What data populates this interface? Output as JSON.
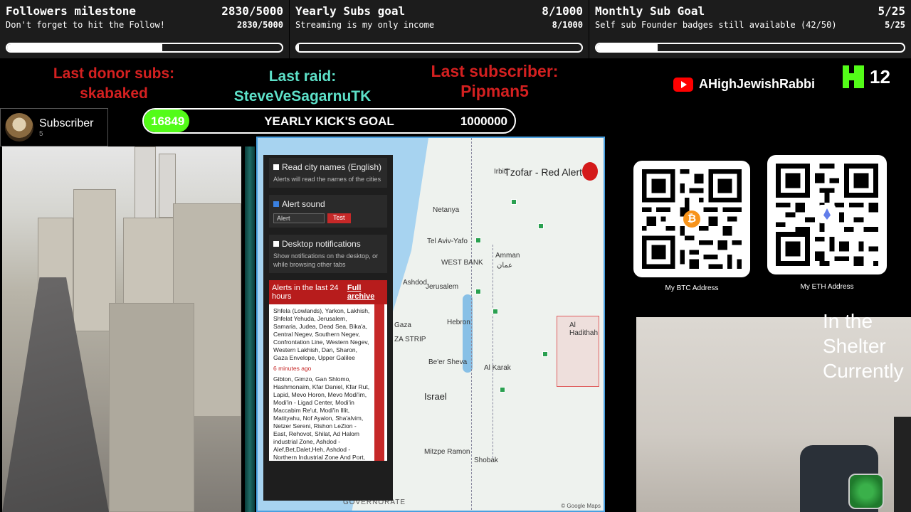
{
  "goals": [
    {
      "title": "Followers milestone",
      "count": "2830/5000",
      "subtitle": "Don't forget to hit the Follow!",
      "sub_count": "2830/5000",
      "progress": 0.566
    },
    {
      "title": "Yearly Subs goal",
      "count": "8/1000",
      "subtitle": "Streaming is my only income",
      "sub_count": "8/1000",
      "progress": 0.008
    },
    {
      "title": "Monthly Sub Goal",
      "count": "5/25",
      "subtitle": "Self sub Founder badges still available (42/50)",
      "sub_count": "5/25",
      "progress": 0.2
    }
  ],
  "events": {
    "donor_label": "Last donor subs:",
    "donor_name": "skabaked",
    "raid_label": "Last raid:",
    "raid_name": "SteveVeSagarnuTK",
    "sub_label": "Last subscriber:",
    "sub_name": "Pipman5"
  },
  "channel": {
    "name": "AHighJewishRabbi",
    "icon": "youtube-icon"
  },
  "kick": {
    "count": "12",
    "icon": "kick-icon"
  },
  "subscriber_card": {
    "label": "Subscriber",
    "count": "5"
  },
  "kick_goal": {
    "current": "16849",
    "title": "YEARLY KICK'S GOAL",
    "target": "1000000",
    "progress": 0.016849
  },
  "alert_app": {
    "title": "Tzofar - Red Alert",
    "opt_city_names": "Read city names (English)",
    "opt_city_desc": "Alerts will read the names of the cities",
    "opt_alert_sound": "Alert sound",
    "sound_select": "Alert",
    "test_button": "Test",
    "opt_desktop": "Desktop notifications",
    "opt_desktop_desc": "Show notifications on the desktop, or while browsing other tabs",
    "alerts_header": "Alerts in the last 24 hours",
    "full_archive": "Full archive",
    "alert_1": "Shfela (Lowlands), Yarkon, Lakhish, Shfelat Yehuda, Jerusalem, Samaria, Judea, Dead Sea, Bika'a, Central Negev, Southern Negev, Confrontation Line, Western Negev, Western Lakhish, Dan, Sharon, Gaza Envelope, Upper Galilee",
    "alert_1_time": "6 minutes ago",
    "alert_2": "Gibton, Gimzo, Gan Shlomo, Hashmonaim, Kfar Daniel, Kfar Rut, Lapid, Mevo Horon, Mevo Modi'im, Modi'in - Ligad Center, Modi'in Maccabim Re'ut, Modi'in Illit, Matityahu, Nof Ayalon, Sha'alvim, Netzer Sereni, Rishon LeZion - East, Rehovot, Shilat, Ad Halom industrial Zone, Ashdod - Alef,Bet,Dalet,Heh, Ashdod - Northern Industrial Zone And Port, Ashdod -",
    "map_labels": {
      "netanya": "Netanya",
      "tel_aviv": "Tel Aviv-Yafo",
      "west_bank": "WEST BANK",
      "amman": "Amman",
      "amman_ar": "عمان",
      "ashdod": "Ashdod",
      "jerusalem": "Jerusalem",
      "gaza": "Gaza",
      "gaza_strip": "ZA STRIP",
      "hebron": "Hebron",
      "beer_sheva": "Be'er Sheva",
      "israel": "Israel",
      "irbid": "Irbid",
      "al_hadithah": "Al Hadithah",
      "al_karak": "Al Karak",
      "mitzpe_ramon": "Mitzpe Ramon",
      "shobak": "Shobak",
      "governorate": "GOVERNORATE",
      "google": "© Google Maps"
    }
  },
  "qr": [
    {
      "label": "My BTC Address",
      "center": "bitcoin-icon",
      "color": "#f7931a"
    },
    {
      "label": "My ETH Address",
      "center": "ethereum-icon",
      "color": "#627eea"
    }
  ],
  "webcam": {
    "caption": "In the Shelter Currently"
  },
  "colors": {
    "red": "#d42020",
    "teal": "#5de0c8",
    "kick_green": "#53fc18"
  }
}
